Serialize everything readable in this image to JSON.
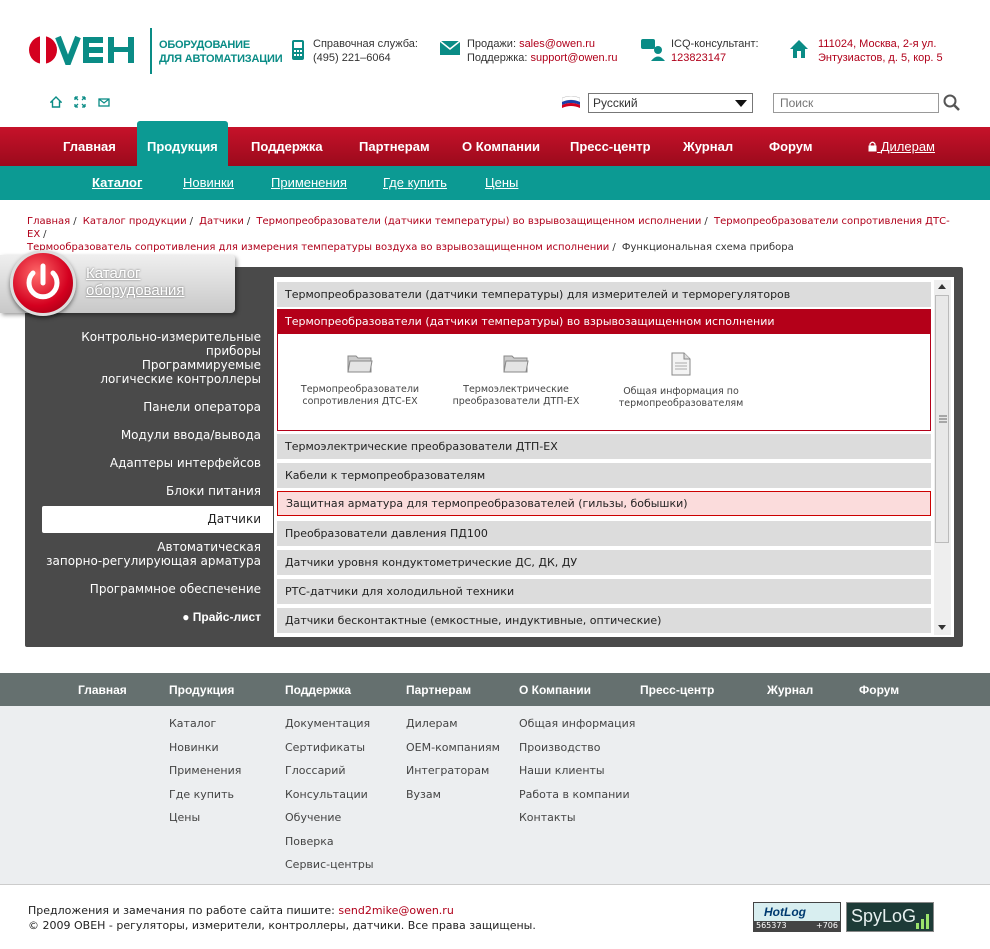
{
  "header": {
    "logo_text": "ОВЕН",
    "tagline_line1": "ОБОРУДОВАНИЕ",
    "tagline_line2": "ДЛЯ АВТОМАТИЗАЦИИ",
    "help": {
      "label": "Справочная служба:",
      "phone": "(495) 221–6064"
    },
    "sales": {
      "label": "Продажи:",
      "email": "sales@owen.ru",
      "support_label": "Поддержка:",
      "support_email": "support@owen.ru"
    },
    "icq": {
      "label": "ICQ-консультант:",
      "number": "123823147"
    },
    "address": {
      "line1": "111024, Москва, 2-я ул.",
      "line2": "Энтузиастов, д. 5, кор. 5"
    },
    "language": "Русский",
    "search_placeholder": "Поиск"
  },
  "mainnav": {
    "items": [
      "Главная",
      "Продукция",
      "Поддержка",
      "Партнерам",
      "О Компании",
      "Пресс-центр",
      "Журнал",
      "Форум"
    ],
    "dealers": "Дилерам"
  },
  "subnav": {
    "items": [
      "Каталог",
      "Новинки",
      "Применения",
      "Где купить",
      "Цены"
    ]
  },
  "breadcrumb": {
    "items": [
      "Главная",
      "Каталог продукции",
      "Датчики",
      "Термопреобразователи (датчики температуры) во взрывозащищенном исполнении",
      "Термопреобразователи сопротивления ДТС-ЕХ",
      "Термообразователь сопротивления для измерения температуры воздуха во взрывозащищенном исполнении"
    ],
    "current": "Функциональная схема прибора"
  },
  "catalog": {
    "title_line1": "Каталог",
    "title_line2": "оборудования",
    "side_items": [
      [
        "Контрольно-измерительные приборы"
      ],
      [
        "Программируемые",
        "логические контроллеры"
      ],
      [
        "Панели оператора"
      ],
      [
        "Модули ввода/вывода"
      ],
      [
        "Адаптеры интерфейсов"
      ],
      [
        "Блоки питания"
      ],
      [
        "Датчики"
      ],
      [
        "Автоматическая",
        "запорно-регулирующая арматура"
      ],
      [
        "Программное обеспечение"
      ]
    ],
    "price_list": "● Прайс-лист",
    "rows": [
      "Термопреобразователи (датчики температуры) для измерителей и терморегуляторов",
      "Термопреобразователи (датчики температуры) во взрывозащищенном исполнении",
      "Термоэлектрические преобразователи ДТП-ЕХ",
      "Кабели к термопреобразователям",
      "Защитная арматура для термопреобразователей (гильзы, бобышки)",
      "Преобразователи давления ПД100",
      "Датчики уровня кондуктометрические ДС, ДК, ДУ",
      "РТС-датчики для холодильной техники",
      "Датчики бесконтактные (емкостные, индуктивные, оптические)"
    ],
    "sub_items": [
      [
        "Термопреобразователи",
        "сопротивления ДТС-ЕХ"
      ],
      [
        "Термоэлектрические",
        "преобразователи ДТП-ЕХ"
      ],
      [
        "Общая информация по",
        "термопреобразователям"
      ]
    ]
  },
  "footer": {
    "nav": [
      "Главная",
      "Продукция",
      "Поддержка",
      "Партнерам",
      "О Компании",
      "Пресс-центр",
      "Журнал",
      "Форум"
    ],
    "cols": {
      "products": [
        "Каталог",
        "Новинки",
        "Применения",
        "Где купить",
        "Цены"
      ],
      "support": [
        "Документация",
        "Сертификаты",
        "Глоссарий",
        "Консультации",
        "Обучение",
        "Поверка",
        "Сервис-центры"
      ],
      "partners": [
        "Дилерам",
        "OEM-компаниям",
        "Интеграторам",
        "Вузам"
      ],
      "company": [
        "Общая информация",
        "Производство",
        "Наши клиенты",
        "Работа в компании",
        "Контакты"
      ]
    },
    "feedback_label": "Предложения и замечания по работе сайта пишите:",
    "feedback_email": "send2mike@owen.ru",
    "copyright": "© 2009 ОВЕН - регуляторы, измерители, контроллеры, датчики. Все права защищены.",
    "hotlog": {
      "title": "HotLog",
      "count": "565373",
      "delta": "+706"
    },
    "spylog": "SpyLoG"
  },
  "colors": {
    "brand_red": "#b40019",
    "teal": "#0c9a93",
    "dark_panel": "#4a4a4a",
    "footer_gray": "#65706f"
  }
}
